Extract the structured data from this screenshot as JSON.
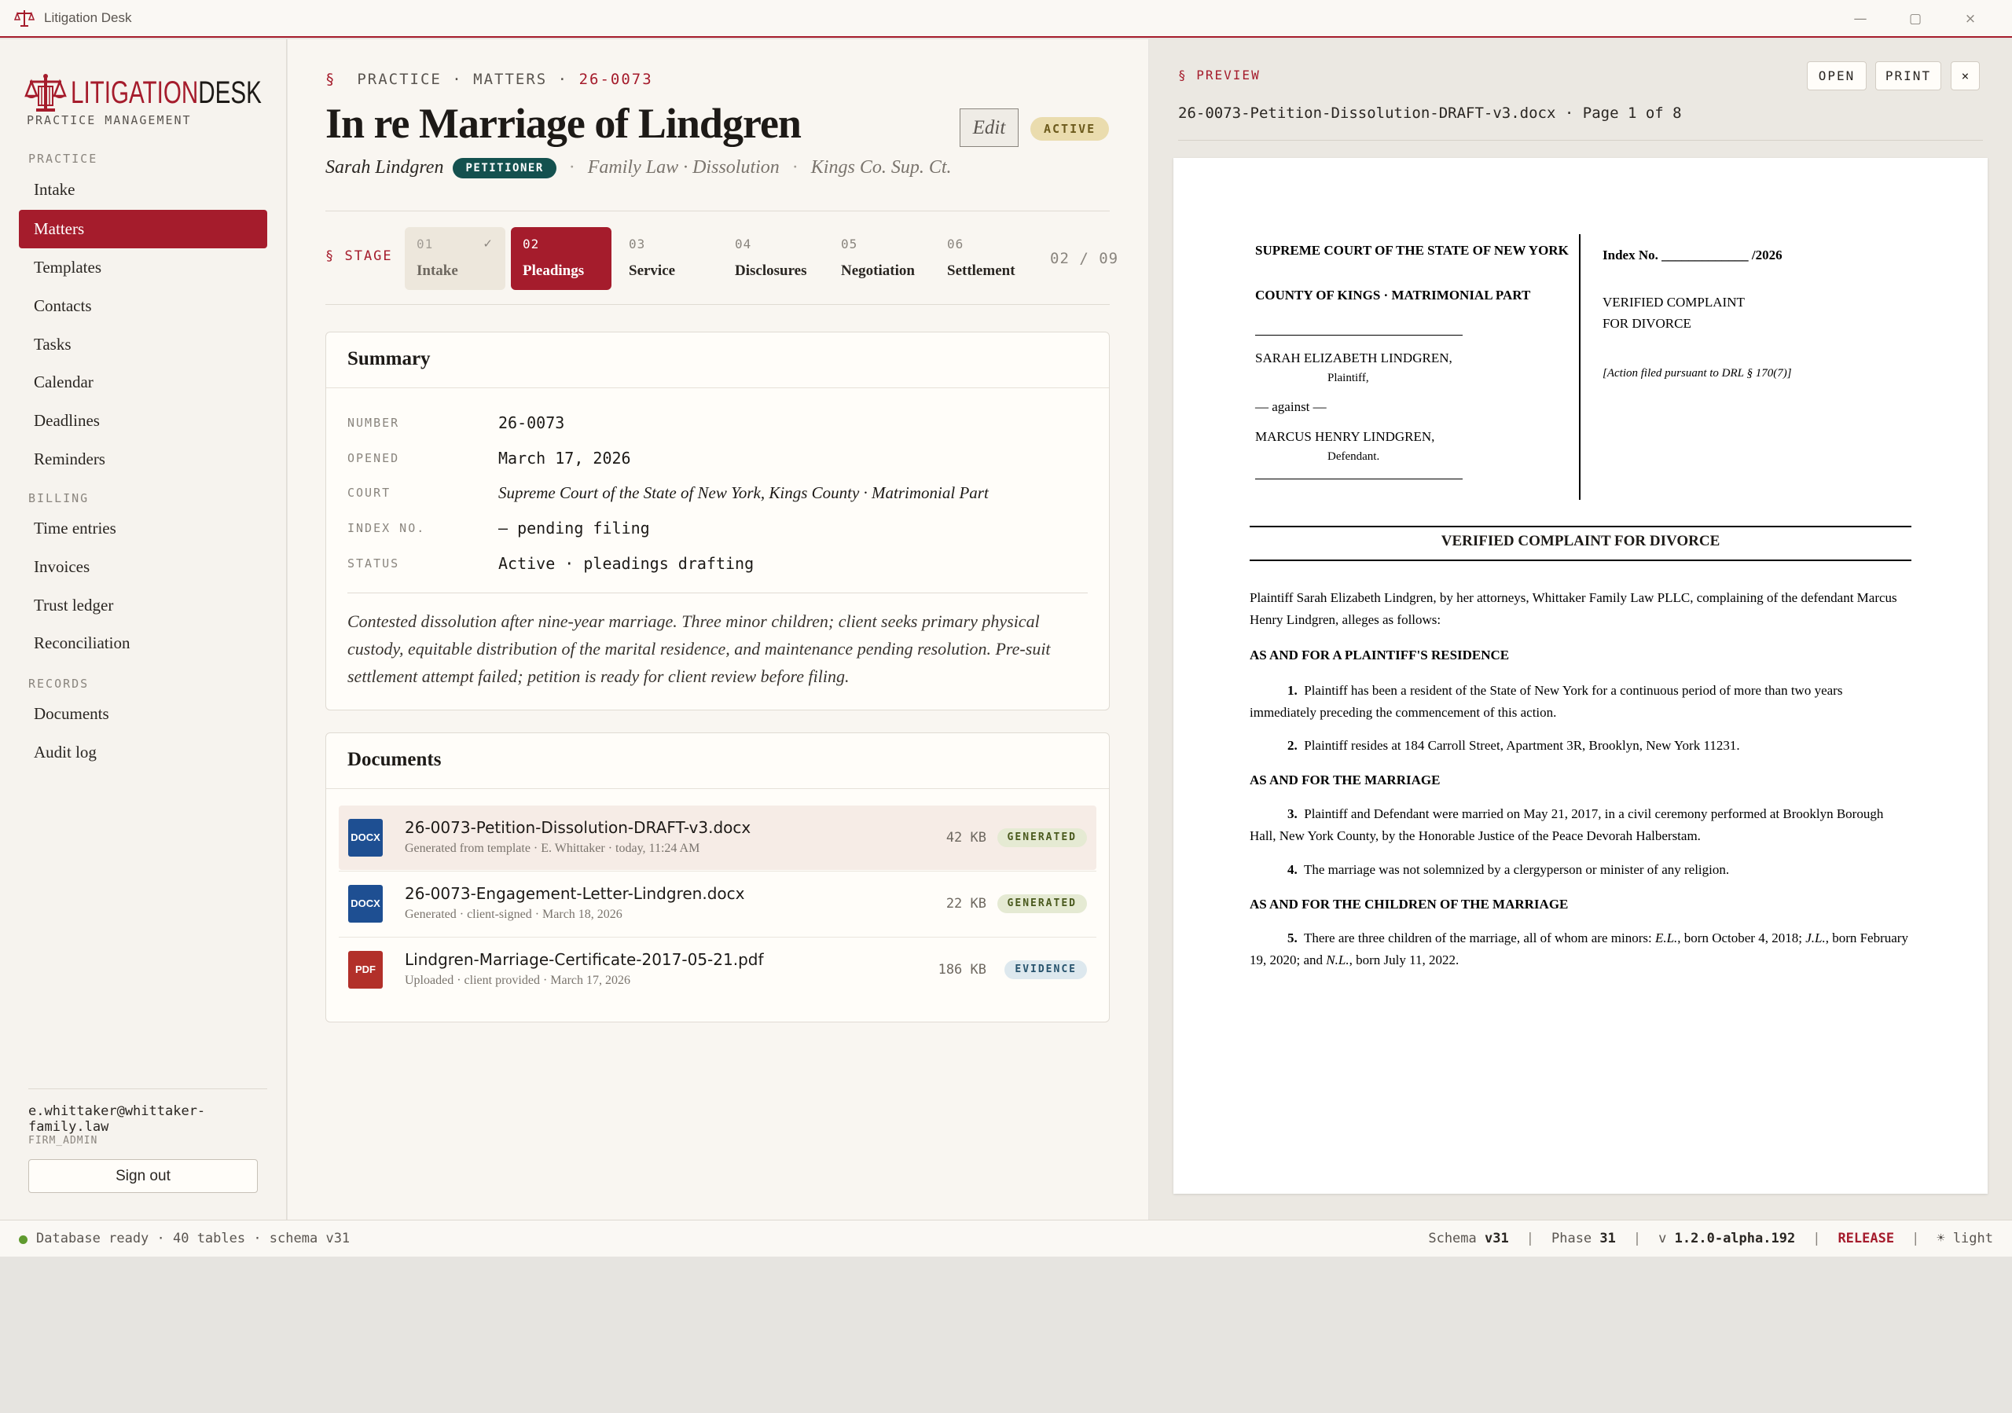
{
  "window": {
    "title": "Litigation Desk",
    "controls": {
      "minimize": "—",
      "maximize": "▢",
      "close": "×"
    }
  },
  "sidebar": {
    "logo_word1": "LITIGATION",
    "logo_word2": "DESK",
    "logo_sub": "PRACTICE MANAGEMENT",
    "sections": [
      {
        "label": "PRACTICE",
        "items": [
          "Intake",
          "Matters",
          "Templates",
          "Contacts",
          "Tasks",
          "Calendar",
          "Deadlines",
          "Reminders"
        ]
      },
      {
        "label": "BILLING",
        "items": [
          "Time entries",
          "Invoices",
          "Trust ledger",
          "Reconciliation"
        ]
      },
      {
        "label": "RECORDS",
        "items": [
          "Documents",
          "Audit log"
        ]
      }
    ],
    "active_item": "Matters",
    "user_email": "e.whittaker@whittaker-family.law",
    "user_role": "FIRM_ADMIN",
    "signout_label": "Sign out"
  },
  "matter": {
    "breadcrumb": {
      "symbol": "§",
      "path": "PRACTICE · MATTERS ·",
      "number": "26-0073"
    },
    "title": "In re Marriage of Lindgren",
    "edit_label": "Edit",
    "status_badge": "ACTIVE",
    "client": "Sarah Lindgren",
    "role_badge": "PETITIONER",
    "separator": "·",
    "practice_area": "Family Law · Dissolution",
    "court_short": "Kings Co. Sup. Ct.",
    "stage_label": "§ STAGE",
    "stages": [
      {
        "num": "01",
        "name": "Intake",
        "state": "done",
        "mark": "✓"
      },
      {
        "num": "02",
        "name": "Pleadings",
        "state": "current"
      },
      {
        "num": "03",
        "name": "Service",
        "state": "todo"
      },
      {
        "num": "04",
        "name": "Disclosures",
        "state": "todo"
      },
      {
        "num": "05",
        "name": "Negotiation",
        "state": "todo"
      },
      {
        "num": "06",
        "name": "Settlement",
        "state": "todo"
      }
    ],
    "stage_count": "02 / 09"
  },
  "summary": {
    "title": "Summary",
    "rows": [
      {
        "key": "NUMBER",
        "value": "26-0073"
      },
      {
        "key": "OPENED",
        "value": "March 17, 2026"
      },
      {
        "key": "COURT",
        "value": "Supreme Court of the State of New York, Kings County · Matrimonial Part"
      },
      {
        "key": "INDEX NO.",
        "value": "— pending filing"
      },
      {
        "key": "STATUS",
        "value": "Active · pleadings drafting"
      }
    ],
    "note": "Contested dissolution after nine-year marriage. Three minor children; client seeks primary physical custody, equitable distribution of the marital residence, and maintenance pending resolution. Pre-suit settlement attempt failed; petition is ready for client review before filing."
  },
  "documents": {
    "title": "Documents",
    "items": [
      {
        "type": "DOCX",
        "name": "26-0073-Petition-Dissolution-DRAFT-v3.docx",
        "meta": "Generated from template · E. Whittaker · today, 11:24 AM",
        "size": "42 KB",
        "badge": "GENERATED"
      },
      {
        "type": "DOCX",
        "name": "26-0073-Engagement-Letter-Lindgren.docx",
        "meta": "Generated · client-signed · March 18, 2026",
        "size": "22 KB",
        "badge": "GENERATED"
      },
      {
        "type": "PDF",
        "name": "Lindgren-Marriage-Certificate-2017-05-21.pdf",
        "meta": "Uploaded · client provided · March 17, 2026",
        "size": "186 KB",
        "badge": "EVIDENCE"
      }
    ]
  },
  "preview": {
    "label": "§ PREVIEW",
    "open_label": "OPEN",
    "print_label": "PRINT",
    "close_label": "×",
    "file_line": "26-0073-Petition-Dissolution-DRAFT-v3.docx · Page 1 of 8",
    "page": {
      "court_line1": "SUPREME COURT OF THE STATE OF NEW YORK",
      "court_line2": "COUNTY OF KINGS · MATRIMONIAL PART",
      "plaintiff": "SARAH ELIZABETH LINDGREN,",
      "plaintiff_role": "Plaintiff,",
      "against": "— against —",
      "defendant": "MARCUS HENRY LINDGREN,",
      "defendant_role": "Defendant.",
      "index_label": "Index No.",
      "index_blank": "_____________",
      "index_year": "/2026",
      "doc_type_1": "VERIFIED COMPLAINT",
      "doc_type_2": "FOR DIVORCE",
      "drl_note": "[Action filed pursuant to DRL § 170(7)]",
      "heading": "VERIFIED COMPLAINT FOR DIVORCE",
      "intro": "Plaintiff Sarah Elizabeth Lindgren, by her attorneys, Whittaker Family Law PLLC, complaining of the defendant Marcus Henry Lindgren, alleges as follows:",
      "sec1": "AS AND FOR A PLAINTIFF'S RESIDENCE",
      "p1_num": "1.",
      "p1": "Plaintiff has been a resident of the State of New York for a continuous period of more than two years immediately preceding the commencement of this action.",
      "p2_num": "2.",
      "p2": "Plaintiff resides at 184 Carroll Street, Apartment 3R, Brooklyn, New York 11231.",
      "sec2": "AS AND FOR THE MARRIAGE",
      "p3_num": "3.",
      "p3": "Plaintiff and Defendant were married on May 21, 2017, in a civil ceremony performed at Brooklyn Borough Hall, New York County, by the Honorable Justice of the Peace Devorah Halberstam.",
      "p4_num": "4.",
      "p4": "The marriage was not solemnized by a clergyperson or minister of any religion.",
      "sec3": "AS AND FOR THE CHILDREN OF THE MARRIAGE",
      "p5_num": "5.",
      "p5_a": "There are three children of the marriage, all of whom are minors: ",
      "p5_c1": "E.L.",
      "p5_b": ", born October 4, 2018; ",
      "p5_c2": "J.L.",
      "p5_c": ", born February 19, 2020; and ",
      "p5_c3": "N.L.",
      "p5_d": ", born July 11, 2022."
    }
  },
  "statusbar": {
    "db_status": "Database ready · 40 tables · schema v31",
    "schema_label": "Schema",
    "schema_value": "v31",
    "phase_label": "Phase",
    "phase_value": "31",
    "version_label": "v",
    "version_value": "1.2.0-alpha.192",
    "channel": "RELEASE",
    "theme": "☀ light",
    "sep": "|"
  },
  "colors": {
    "accent": "#a51c2c",
    "teal": "#14514f",
    "ok": "#5f9a2e"
  }
}
